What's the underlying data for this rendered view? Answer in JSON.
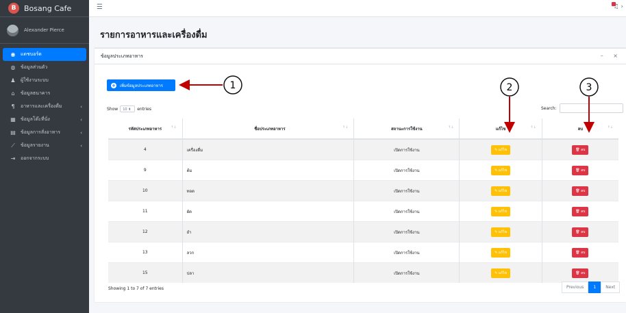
{
  "brand": {
    "name": "Bosang Cafe",
    "logo_letter": "B"
  },
  "user": {
    "name": "Alexander Pierce"
  },
  "sidebar": {
    "items": [
      {
        "label": "แดชบอร์ด",
        "icon": "dashboard-icon",
        "active": true,
        "arrow": ""
      },
      {
        "label": "ข้อมูลส่วนตัว",
        "icon": "user-circle-icon",
        "active": false,
        "arrow": ""
      },
      {
        "label": "ผู้ใช้งานระบบ",
        "icon": "users-icon",
        "active": false,
        "arrow": ""
      },
      {
        "label": "ข้อมูลธนาคาร",
        "icon": "bank-icon",
        "active": false,
        "arrow": ""
      },
      {
        "label": "อาหารและเครื่องดื่ม",
        "icon": "utensils-icon",
        "active": false,
        "arrow": "‹"
      },
      {
        "label": "ข้อมูลโต๊ะที่นั่ง",
        "icon": "table-icon",
        "active": false,
        "arrow": "‹"
      },
      {
        "label": "ข้อมูลการสั่งอาหาร",
        "icon": "clipboard-icon",
        "active": false,
        "arrow": "‹"
      },
      {
        "label": "ข้อมูลรายงาน",
        "icon": "chart-icon",
        "active": false,
        "arrow": "‹"
      },
      {
        "label": "ออกจากระบบ",
        "icon": "logout-icon",
        "active": false,
        "arrow": ""
      }
    ]
  },
  "page": {
    "title": "รายการอาหารและเครื่องดื่ม"
  },
  "card": {
    "title": "ข้อมูลประเภทอาหาร",
    "add_button": "เพิ่มข้อมูลประเภทอาหาร",
    "show_label": "Show",
    "entries_value": "10",
    "entries_label": "entries",
    "search_label": "Search:",
    "showing_text": "Showing 1 to 7 of 7 entries"
  },
  "table": {
    "headers": [
      "รหัสประเภทอาหาร",
      "ชื่อประเภทอาหาร",
      "สถานะการใช้งาน",
      "แก้ไข",
      "ลบ"
    ],
    "edit_label": "แก้ไข",
    "delete_label": "ลบ",
    "rows": [
      {
        "id": "4",
        "name": "เครื่องดื่ม",
        "status": "เปิดการใช้งาน"
      },
      {
        "id": "9",
        "name": "ต้ม",
        "status": "เปิดการใช้งาน"
      },
      {
        "id": "10",
        "name": "ทอด",
        "status": "เปิดการใช้งาน"
      },
      {
        "id": "11",
        "name": "ผัด",
        "status": "เปิดการใช้งาน"
      },
      {
        "id": "12",
        "name": "ยำ",
        "status": "เปิดการใช้งาน"
      },
      {
        "id": "13",
        "name": "ลวก",
        "status": "เปิดการใช้งาน"
      },
      {
        "id": "15",
        "name": "ปลา",
        "status": "เปิดการใช้งาน"
      }
    ]
  },
  "pagination": {
    "previous": "Previous",
    "current": "1",
    "next": "Next"
  },
  "annotations": [
    "1",
    "2",
    "3"
  ],
  "colors": {
    "primary": "#007bff",
    "warning": "#ffc107",
    "danger": "#dc3545",
    "sidebar": "#343a40",
    "arrow": "#c00000"
  }
}
